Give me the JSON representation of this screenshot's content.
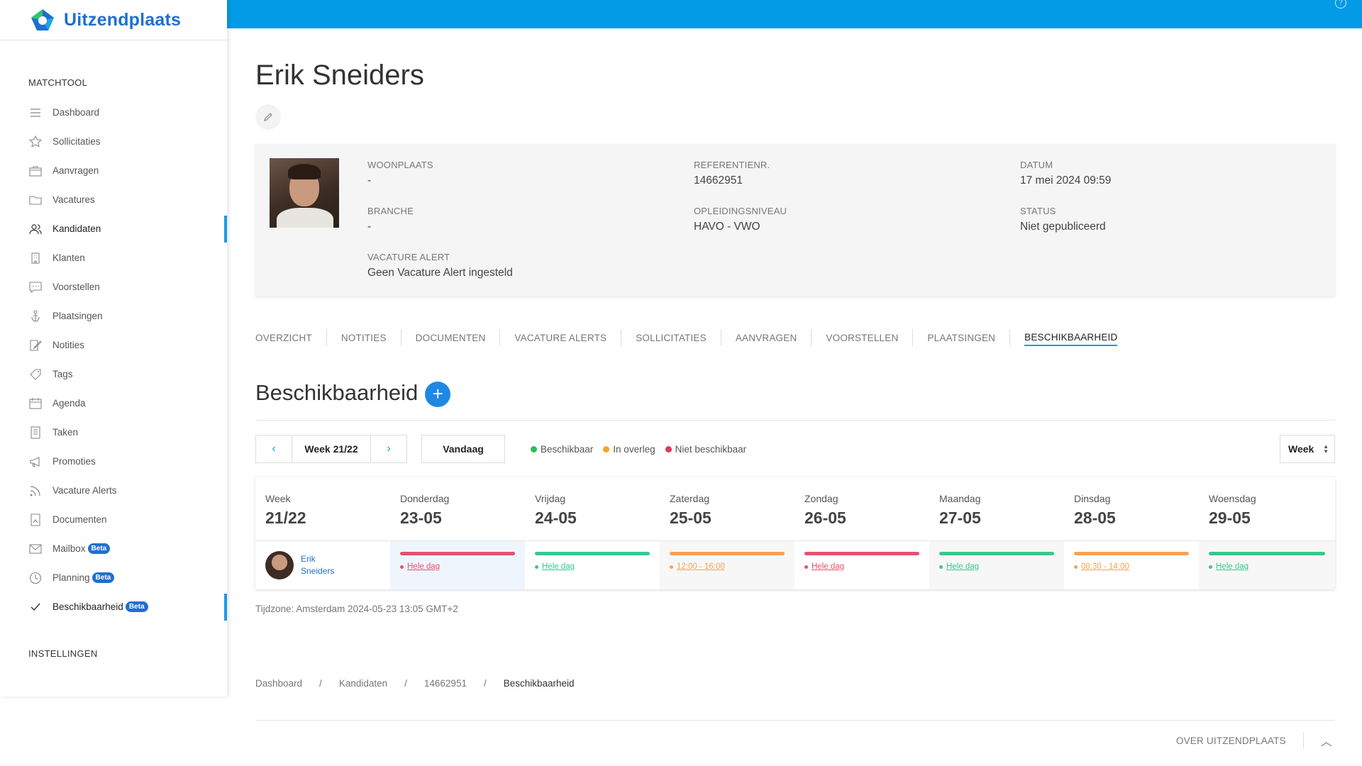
{
  "brand": {
    "name": "Uitzendplaats",
    "color": "#1f6fd1",
    "accent": "#039be5"
  },
  "sidebar": {
    "section_matchtool": "MATCHTOOL",
    "section_settings": "INSTELLINGEN",
    "items": [
      {
        "label": "Dashboard",
        "icon": "list-icon"
      },
      {
        "label": "Sollicitaties",
        "icon": "star-icon"
      },
      {
        "label": "Aanvragen",
        "icon": "briefcase-icon"
      },
      {
        "label": "Vacatures",
        "icon": "folder-icon"
      },
      {
        "label": "Kandidaten",
        "icon": "users-icon",
        "active": true
      },
      {
        "label": "Klanten",
        "icon": "building-icon"
      },
      {
        "label": "Voorstellen",
        "icon": "chat-icon"
      },
      {
        "label": "Plaatsingen",
        "icon": "anchor-icon"
      },
      {
        "label": "Notities",
        "icon": "note-icon"
      },
      {
        "label": "Tags",
        "icon": "tag-icon"
      },
      {
        "label": "Agenda",
        "icon": "calendar-icon"
      },
      {
        "label": "Taken",
        "icon": "task-icon"
      },
      {
        "label": "Promoties",
        "icon": "megaphone-icon"
      },
      {
        "label": "Vacature Alerts",
        "icon": "rss-icon"
      },
      {
        "label": "Documenten",
        "icon": "document-icon"
      },
      {
        "label": "Mailbox",
        "icon": "mail-icon",
        "badge": "Beta"
      },
      {
        "label": "Planning",
        "icon": "clock-icon",
        "badge": "Beta"
      },
      {
        "label": "Beschikbaarheid",
        "icon": "check-icon",
        "badge": "Beta",
        "active": true
      }
    ]
  },
  "candidate": {
    "name": "Erik Sneiders",
    "name_first": "Erik",
    "name_last": "Sneiders",
    "fields": {
      "woonplaats_label": "WOONPLAATS",
      "woonplaats": "-",
      "branche_label": "BRANCHE",
      "branche": "-",
      "alert_label": "VACATURE ALERT",
      "alert": "Geen Vacature Alert ingesteld",
      "ref_label": "REFERENTIENR.",
      "ref": "14662951",
      "opleiding_label": "OPLEIDINGSNIVEAU",
      "opleiding": "HAVO - VWO",
      "datum_label": "DATUM",
      "datum": "17 mei 2024 09:59",
      "status_label": "STATUS",
      "status": "Niet gepubliceerd"
    }
  },
  "tabs": [
    "OVERZICHT",
    "NOTITIES",
    "DOCUMENTEN",
    "VACATURE ALERTS",
    "SOLLICITATIES",
    "AANVRAGEN",
    "VOORSTELLEN",
    "PLAATSINGEN",
    "BESCHIKBAARHEID"
  ],
  "section": {
    "title": "Beschikbaarheid",
    "add": "+"
  },
  "toolbar": {
    "prev": "‹",
    "next": "›",
    "week": "Week 21/22",
    "today": "Vandaag",
    "view": "Week",
    "legend": [
      {
        "label": "Beschikbaar",
        "color": "#2ebd59"
      },
      {
        "label": "In overleg",
        "color": "#f5a623"
      },
      {
        "label": "Niet beschikbaar",
        "color": "#e8365d"
      }
    ]
  },
  "calendar": {
    "week_label": "Week",
    "week_value": "21/22",
    "days": [
      {
        "name": "Donderdag",
        "date": "23-05",
        "status": "Hele dag",
        "color": "#e8506e",
        "today": true
      },
      {
        "name": "Vrijdag",
        "date": "24-05",
        "status": "Hele dag",
        "color": "#35c98e"
      },
      {
        "name": "Zaterdag",
        "date": "25-05",
        "status": "12:00 - 16:00",
        "color": "#f7a255",
        "shade": true
      },
      {
        "name": "Zondag",
        "date": "26-05",
        "status": "Hele dag",
        "color": "#e8506e"
      },
      {
        "name": "Maandag",
        "date": "27-05",
        "status": "Hele dag",
        "color": "#35c98e",
        "shade": true
      },
      {
        "name": "Dinsdag",
        "date": "28-05",
        "status": "08:30 - 14:00",
        "color": "#f7a255"
      },
      {
        "name": "Woensdag",
        "date": "29-05",
        "status": "Hele dag",
        "color": "#35c98e",
        "shade": true
      }
    ]
  },
  "timezone": "Tijdzone: Amsterdam 2024-05-23 13:05 GMT+2",
  "breadcrumb": {
    "items": [
      "Dashboard",
      "Kandidaten",
      "14662951",
      "Beschikbaarheid"
    ],
    "sep": "/"
  },
  "footer": {
    "about": "OVER UITZENDPLAATS"
  }
}
